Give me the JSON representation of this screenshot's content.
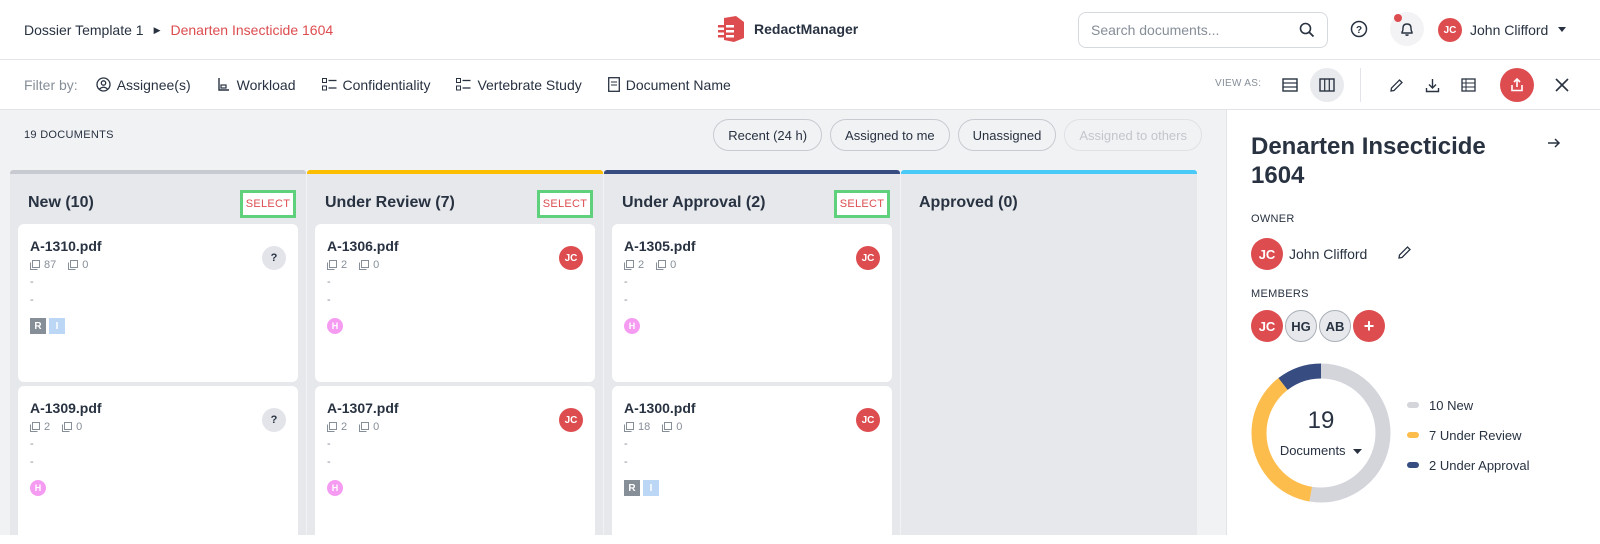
{
  "breadcrumb": {
    "template": "Dossier Template 1",
    "dossier": "Denarten Insecticide 1604"
  },
  "app": {
    "name": "RedactManager",
    "brand_color": "#dd4d50"
  },
  "search": {
    "placeholder": "Search documents..."
  },
  "user": {
    "initials": "JC",
    "name": "John Clifford"
  },
  "filters": {
    "label": "Filter by:",
    "items": [
      {
        "label": "Assignee(s)",
        "icon": "user-circle-icon"
      },
      {
        "label": "Workload",
        "icon": "workload-icon"
      },
      {
        "label": "Confidentiality",
        "icon": "list-icon"
      },
      {
        "label": "Vertebrate Study",
        "icon": "list-icon"
      },
      {
        "label": "Document Name",
        "icon": "document-icon"
      }
    ]
  },
  "view_as": {
    "label": "VIEW AS:"
  },
  "documents": {
    "count_label": "19 DOCUMENTS",
    "quick_filters": [
      "Recent (24 h)",
      "Assigned to me",
      "Unassigned",
      "Assigned to others"
    ]
  },
  "columns": [
    {
      "title": "New (10)",
      "color": "#c7cad0",
      "select_label": "SELECT",
      "cards": [
        {
          "name": "A-1310.pdf",
          "pages": "87",
          "annotations": "0",
          "line1": "-",
          "line2": "-",
          "assignee": "?",
          "tags": [
            "R",
            "I"
          ]
        },
        {
          "name": "A-1309.pdf",
          "pages": "2",
          "annotations": "0",
          "line1": "-",
          "line2": "-",
          "assignee": "?",
          "tags": [
            "H"
          ]
        }
      ]
    },
    {
      "title": "Under Review (7)",
      "color": "#fdbd00",
      "select_label": "SELECT",
      "cards": [
        {
          "name": "A-1306.pdf",
          "pages": "2",
          "annotations": "0",
          "line1": "-",
          "line2": "-",
          "assignee": "JC",
          "tags": [
            "H"
          ]
        },
        {
          "name": "A-1307.pdf",
          "pages": "2",
          "annotations": "0",
          "line1": "-",
          "line2": "-",
          "assignee": "JC",
          "tags": [
            "H"
          ]
        }
      ]
    },
    {
      "title": "Under Approval (2)",
      "color": "#374c81",
      "select_label": "SELECT",
      "cards": [
        {
          "name": "A-1305.pdf",
          "pages": "2",
          "annotations": "0",
          "line1": "-",
          "line2": "-",
          "assignee": "JC",
          "tags": [
            "H"
          ]
        },
        {
          "name": "A-1300.pdf",
          "pages": "18",
          "annotations": "0",
          "line1": "-",
          "line2": "-",
          "assignee": "JC",
          "tags": [
            "R",
            "I"
          ]
        }
      ]
    },
    {
      "title": "Approved (0)",
      "color": "#48c9f7",
      "select_label": "",
      "cards": []
    }
  ],
  "panel": {
    "title": "Denarten Insecticide 1604",
    "owner_label": "OWNER",
    "owner": {
      "initials": "JC",
      "name": "John Clifford"
    },
    "members_label": "MEMBERS",
    "members": [
      "JC",
      "HG",
      "AB"
    ],
    "add_member": "+",
    "donut": {
      "total": "19",
      "label": "Documents",
      "segments": [
        {
          "label": "10 New",
          "value": 10,
          "color": "#d3d5da"
        },
        {
          "label": "7 Under Review",
          "value": 7,
          "color": "#fdbd4c"
        },
        {
          "label": "2 Under Approval",
          "value": 2,
          "color": "#374c81"
        }
      ]
    }
  }
}
